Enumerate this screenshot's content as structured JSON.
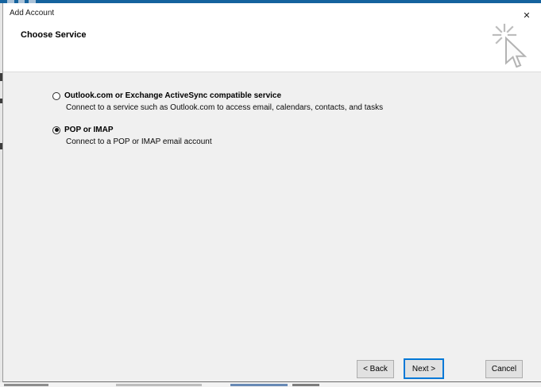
{
  "colors": {
    "bg_behind_blue": "#15639E",
    "dialog_bg": "#F0F0F0",
    "button_bg": "#E1E1E1",
    "button_border": "#ADADAD",
    "focus_border": "#0078D7"
  },
  "window": {
    "title": "Add Account"
  },
  "icons": {
    "close": "✕",
    "cursor": "arrow-click-cursor"
  },
  "header": {
    "title": "Choose Service"
  },
  "options": [
    {
      "label": "Outlook.com or Exchange ActiveSync compatible service",
      "description": "Connect to a service such as Outlook.com to access email, calendars, contacts, and tasks",
      "selected": false
    },
    {
      "label": "POP or IMAP",
      "description": "Connect to a POP or IMAP email account",
      "selected": true
    }
  ],
  "footer_buttons": {
    "back": "< Back",
    "next": "Next >",
    "cancel": "Cancel"
  },
  "focused_button": "next"
}
